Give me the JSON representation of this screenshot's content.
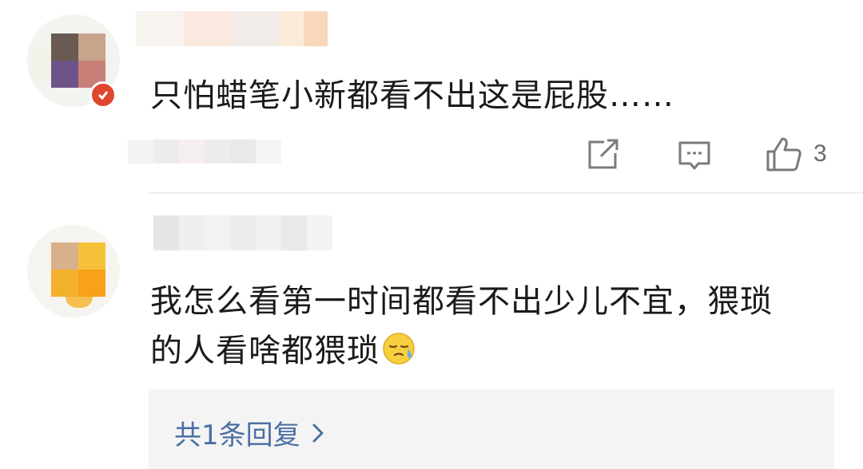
{
  "comments": [
    {
      "text": "只怕蜡笔小新都看不出这是屁股……",
      "like_count": "3"
    },
    {
      "text_line1": "我怎么看第一时间都看不出少儿不宜，猥琐",
      "text_line2": "的人看啥都猥琐",
      "emoji": "sweat-face-emoji"
    }
  ],
  "replies": {
    "label": "共1条回复"
  },
  "icons": {
    "share": "share-icon",
    "reply": "comment-icon",
    "like": "thumbs-up-icon",
    "chevron": "chevron-right-icon",
    "badge": "verified-badge-icon"
  },
  "colors": {
    "text": "#1a1a1a",
    "meta": "#6b6b6b",
    "link": "#4a6fa5",
    "divider": "#ececec",
    "reply_bg": "#f4f4f4",
    "badge": "#e0452f"
  }
}
